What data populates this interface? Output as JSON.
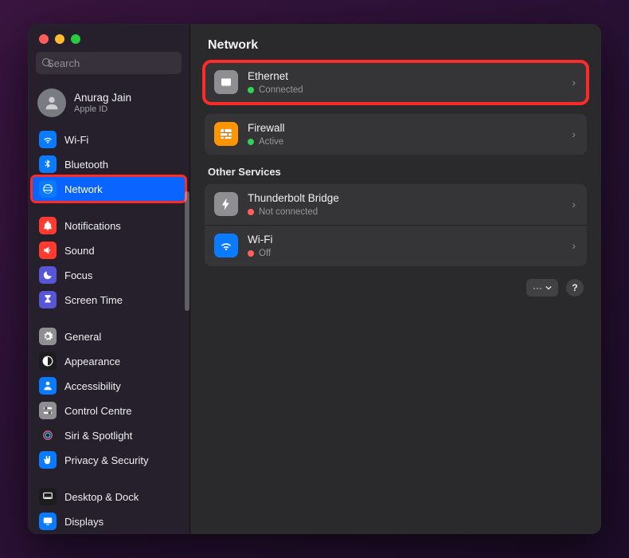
{
  "search": {
    "placeholder": "Search"
  },
  "account": {
    "name": "Anurag Jain",
    "sub": "Apple ID"
  },
  "sidebar": {
    "items": [
      {
        "label": "Wi-Fi",
        "icon": "wifi",
        "icon_bg": "#0a7bff"
      },
      {
        "label": "Bluetooth",
        "icon": "bluetooth",
        "icon_bg": "#0a7bff"
      },
      {
        "label": "Network",
        "icon": "globe",
        "icon_bg": "#0a7bff",
        "active": true,
        "highlight": true
      },
      {
        "label": "Notifications",
        "icon": "bell",
        "icon_bg": "#ff3b30"
      },
      {
        "label": "Sound",
        "icon": "speaker",
        "icon_bg": "#ff3b30"
      },
      {
        "label": "Focus",
        "icon": "moon",
        "icon_bg": "#5856d6"
      },
      {
        "label": "Screen Time",
        "icon": "hourglass",
        "icon_bg": "#5856d6"
      },
      {
        "label": "General",
        "icon": "gear",
        "icon_bg": "#8e8e93"
      },
      {
        "label": "Appearance",
        "icon": "contrast",
        "icon_bg": "#1c1c1e"
      },
      {
        "label": "Accessibility",
        "icon": "person",
        "icon_bg": "#0a7bff"
      },
      {
        "label": "Control Centre",
        "icon": "switches",
        "icon_bg": "#8e8e93"
      },
      {
        "label": "Siri & Spotlight",
        "icon": "siri",
        "icon_bg": "#222"
      },
      {
        "label": "Privacy & Security",
        "icon": "hand",
        "icon_bg": "#0a7bff"
      },
      {
        "label": "Desktop & Dock",
        "icon": "dock",
        "icon_bg": "#1c1c1e"
      },
      {
        "label": "Displays",
        "icon": "display",
        "icon_bg": "#0a7bff"
      }
    ]
  },
  "main": {
    "title": "Network",
    "primary": [
      {
        "title": "Ethernet",
        "status": "Connected",
        "dot": "green",
        "icon": "ethernet",
        "icon_bg": "#8e8e93",
        "highlight": true
      },
      {
        "title": "Firewall",
        "status": "Active",
        "dot": "green",
        "icon": "firewall",
        "icon_bg": "#ff9500"
      }
    ],
    "other_label": "Other Services",
    "other": [
      {
        "title": "Thunderbolt Bridge",
        "status": "Not connected",
        "dot": "red",
        "icon": "bolt",
        "icon_bg": "#8e8e93"
      },
      {
        "title": "Wi-Fi",
        "status": "Off",
        "dot": "red",
        "icon": "wifi",
        "icon_bg": "#0a7bff"
      }
    ],
    "more_menu": "···",
    "help": "?"
  }
}
